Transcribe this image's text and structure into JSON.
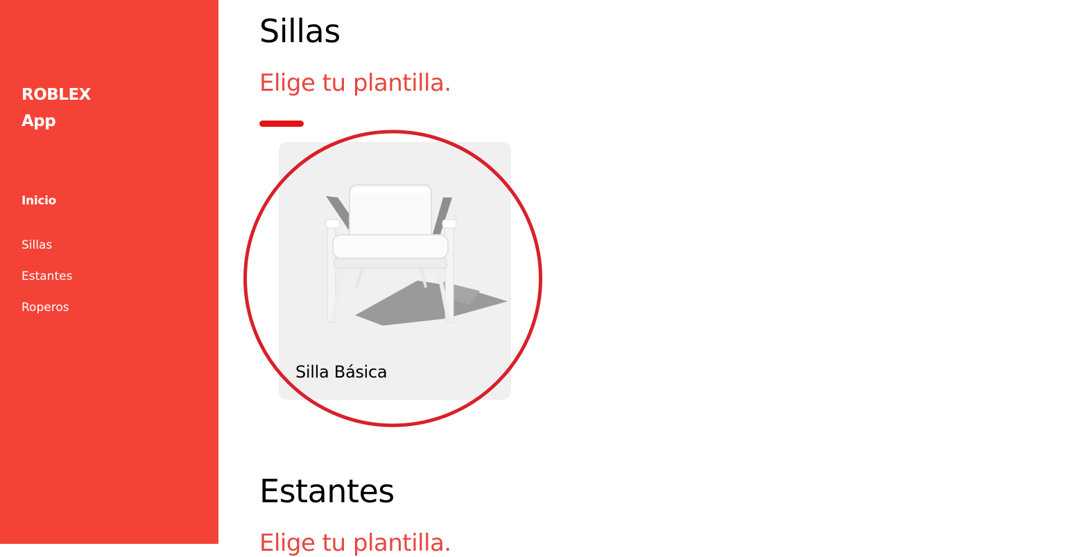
{
  "sidebar": {
    "brand_line1": "ROBLEX",
    "brand_line2": "App",
    "home_label": "Inicio",
    "items": [
      {
        "label": "Sillas"
      },
      {
        "label": "Estantes"
      },
      {
        "label": "Roperos"
      }
    ]
  },
  "sections": [
    {
      "title": "Sillas",
      "subtitle": "Elige tu plantilla.",
      "cards": [
        {
          "label": "Silla Básica",
          "image_icon": "armchair-image"
        }
      ]
    },
    {
      "title": "Estantes",
      "subtitle": "Elige tu plantilla."
    }
  ],
  "colors": {
    "sidebar_bg": "#f44336",
    "accent_text": "#e8463e",
    "underline": "#e01414",
    "highlight_circle": "#d9202a",
    "card_bg": "#f0f0f0"
  }
}
